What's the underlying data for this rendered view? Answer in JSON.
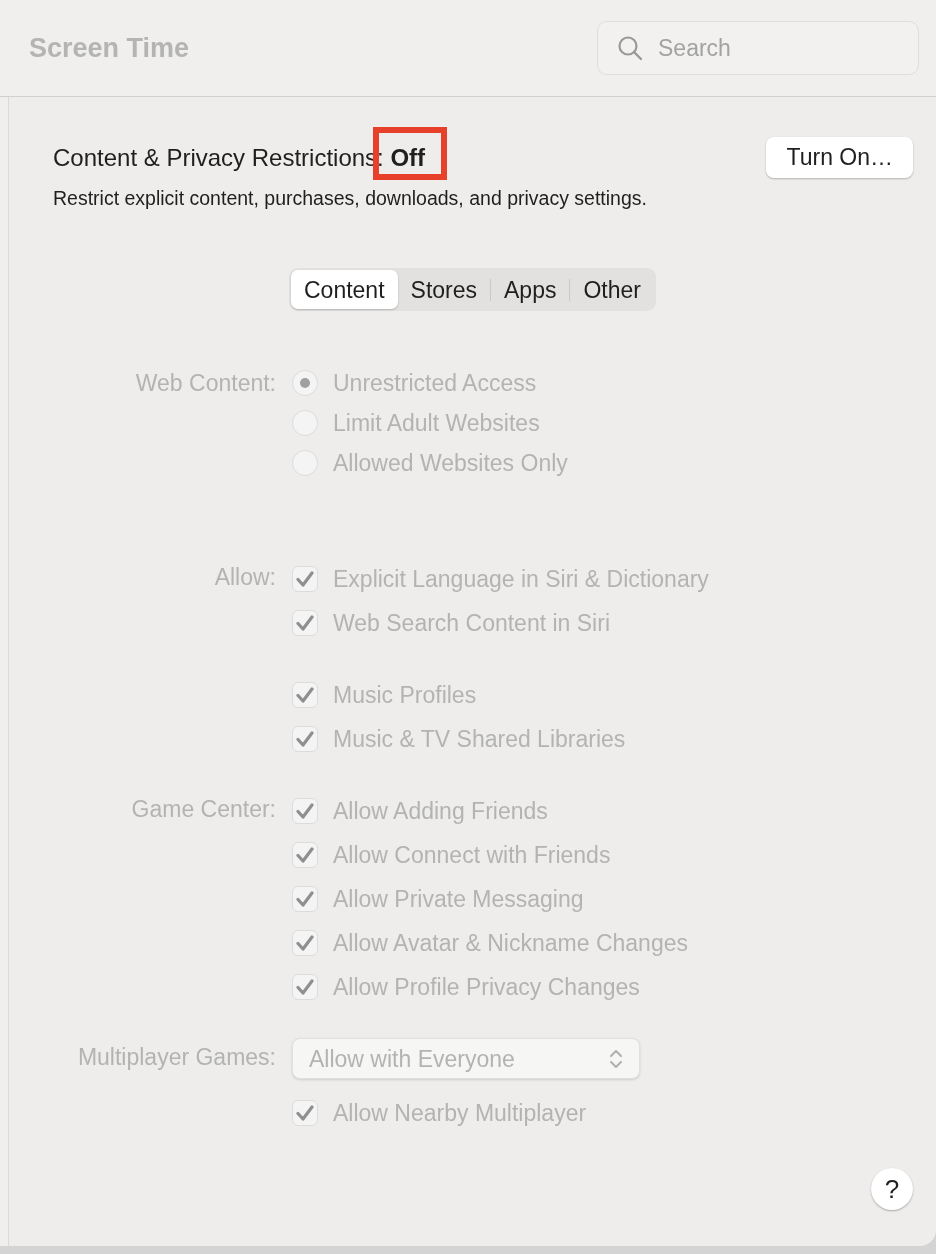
{
  "window": {
    "title": "Screen Time"
  },
  "search": {
    "placeholder": "Search"
  },
  "restrictions": {
    "label": "Content & Privacy Restrictions: **Off**",
    "highlighted": true,
    "description": "Restrict explicit content, purchases, downloads, and privacy settings.",
    "button": "Turn On…"
  },
  "tabs": [
    {
      "label": "Content",
      "selected": true
    },
    {
      "label": "Stores",
      "selected": false
    },
    {
      "label": "Apps",
      "selected": false
    },
    {
      "label": "Other",
      "selected": false
    }
  ],
  "options": {
    "disabled": true,
    "sections": [
      {
        "label": "Web Content:",
        "items": [
          {
            "kind": "radio",
            "label": "Unrestricted Access",
            "selected": true
          },
          {
            "kind": "radio",
            "label": "Limit Adult Websites",
            "selected": false
          },
          {
            "kind": "radio",
            "label": "Allowed Websites Only",
            "selected": false
          }
        ]
      },
      {
        "label": "Allow:",
        "items": [
          {
            "kind": "checkbox",
            "label": "Explicit Language in Siri & Dictionary",
            "checked": true
          },
          {
            "kind": "checkbox",
            "label": "Web Search Content in Siri",
            "checked": true
          }
        ]
      },
      {
        "items": [
          {
            "kind": "checkbox",
            "label": "Music Profiles",
            "checked": true
          },
          {
            "kind": "checkbox",
            "label": "Music & TV Shared Libraries",
            "checked": true
          }
        ]
      },
      {
        "label": "Game Center:",
        "items": [
          {
            "kind": "checkbox",
            "label": "Allow Adding Friends",
            "checked": true
          },
          {
            "kind": "checkbox",
            "label": "Allow Connect with Friends",
            "checked": true
          },
          {
            "kind": "checkbox",
            "label": "Allow Private Messaging",
            "checked": true
          },
          {
            "kind": "checkbox",
            "label": "Allow Avatar & Nickname Changes",
            "checked": true
          },
          {
            "kind": "checkbox",
            "label": "Allow Profile Privacy Changes",
            "checked": true
          }
        ]
      },
      {
        "label": "Multiplayer Games:",
        "items": [
          {
            "kind": "select",
            "value": "Allow with Everyone"
          },
          {
            "kind": "checkbox",
            "label": "Allow Nearby Multiplayer",
            "checked": true
          }
        ]
      }
    ]
  },
  "help": "?"
}
